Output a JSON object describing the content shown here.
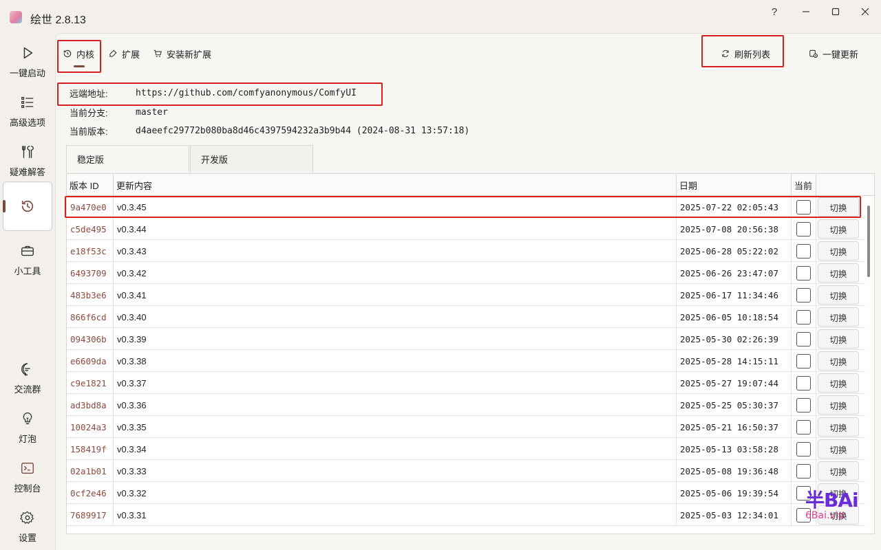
{
  "window": {
    "title": "绘世 2.8.13",
    "buttons": [
      "?",
      "—",
      "☐",
      "✕"
    ]
  },
  "sidebar": {
    "items": [
      {
        "label": "一键启动",
        "icon": "play-icon"
      },
      {
        "label": "高级选项",
        "icon": "list-icon"
      },
      {
        "label": "疑难解答",
        "icon": "wrench-icon"
      },
      {
        "label": "",
        "icon": "history-icon",
        "active": true
      },
      {
        "label": "小工具",
        "icon": "toolbox-icon"
      },
      {
        "label": "交流群",
        "icon": "chat-icon"
      },
      {
        "label": "灯泡",
        "icon": "lightbulb-icon"
      },
      {
        "label": "控制台",
        "icon": "terminal-icon"
      },
      {
        "label": "设置",
        "icon": "gear-icon"
      }
    ]
  },
  "toolbar": {
    "tabs": [
      {
        "label": "内核",
        "icon": "history-icon",
        "active": true
      },
      {
        "label": "扩展",
        "icon": "plug-icon"
      },
      {
        "label": "安装新扩展",
        "icon": "cart-icon"
      }
    ],
    "refresh_label": "刷新列表",
    "update_all_label": "一键更新"
  },
  "info": {
    "remote_label": "远端地址:",
    "remote_value": "https://github.com/comfyanonymous/ComfyUI",
    "branch_label": "当前分支:",
    "branch_value": "master",
    "version_label": "当前版本:",
    "version_value": "d4aeefc29772b080ba8d46c4397594232a3b9b44 (2024-08-31 13:57:18)"
  },
  "subtabs": [
    "稳定版",
    "开发版"
  ],
  "table": {
    "headers": {
      "id": "版本 ID",
      "content": "更新内容",
      "date": "日期",
      "current": "当前"
    },
    "action_label": "切换",
    "rows": [
      {
        "id": "9a470e0",
        "content": "v0.3.45",
        "date": "2025-07-22 02:05:43"
      },
      {
        "id": "c5de495",
        "content": "v0.3.44",
        "date": "2025-07-08 20:56:38"
      },
      {
        "id": "e18f53c",
        "content": "v0.3.43",
        "date": "2025-06-28 05:22:02"
      },
      {
        "id": "6493709",
        "content": "v0.3.42",
        "date": "2025-06-26 23:47:07"
      },
      {
        "id": "483b3e6",
        "content": "v0.3.41",
        "date": "2025-06-17 11:34:46"
      },
      {
        "id": "866f6cd",
        "content": "v0.3.40",
        "date": "2025-06-05 10:18:54"
      },
      {
        "id": "094306b",
        "content": "v0.3.39",
        "date": "2025-05-30 02:26:39"
      },
      {
        "id": "e6609da",
        "content": "v0.3.38",
        "date": "2025-05-28 14:15:11"
      },
      {
        "id": "c9e1821",
        "content": "v0.3.37",
        "date": "2025-05-27 19:07:44"
      },
      {
        "id": "ad3bd8a",
        "content": "v0.3.36",
        "date": "2025-05-25 05:30:37"
      },
      {
        "id": "10024a3",
        "content": "v0.3.35",
        "date": "2025-05-21 16:50:37"
      },
      {
        "id": "158419f",
        "content": "v0.3.34",
        "date": "2025-05-13 03:58:28"
      },
      {
        "id": "02a1b01",
        "content": "v0.3.33",
        "date": "2025-05-08 19:36:48"
      },
      {
        "id": "0cf2e46",
        "content": "v0.3.32",
        "date": "2025-05-06 19:39:54"
      },
      {
        "id": "7689917",
        "content": "v0.3.31",
        "date": "2025-05-03 12:34:01"
      }
    ]
  },
  "watermark": {
    "top": "半BAi",
    "bottom": "6Bai.vip"
  },
  "colors": {
    "accent": "#7b4a3f",
    "highlight": "#d42020",
    "id_text": "#8b4a3c"
  }
}
